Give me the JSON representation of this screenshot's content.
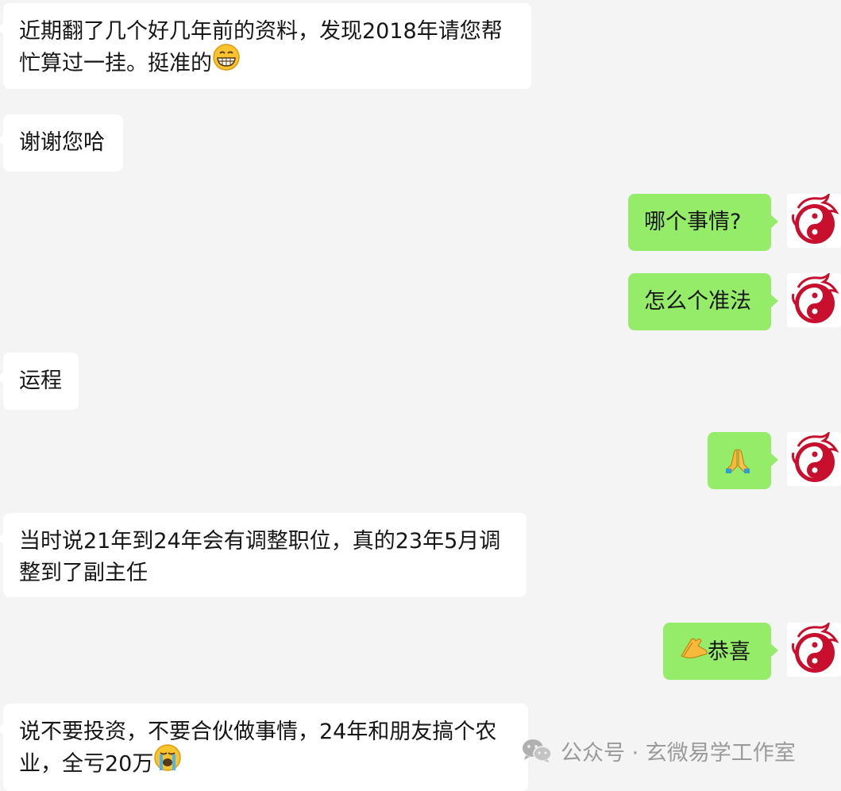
{
  "chat": {
    "messages": [
      {
        "side": "left",
        "lines": [
          "近期翻了几个好几年前的资料，发现2018年请您帮",
          "忙算过一挂。挺准的"
        ],
        "emoji": "grin-emoji"
      },
      {
        "side": "left",
        "lines": [
          "谢谢您哈"
        ]
      },
      {
        "side": "right",
        "lines": [
          "哪个事情?"
        ]
      },
      {
        "side": "right",
        "lines": [
          "怎么个准法"
        ]
      },
      {
        "side": "left",
        "lines": [
          "运程"
        ]
      },
      {
        "side": "right",
        "lines": [
          ""
        ],
        "emoji": "pray-emoji"
      },
      {
        "side": "left",
        "lines": [
          "当时说21年到24年会有调整职位，真的23年5月调",
          "整到了副主任"
        ]
      },
      {
        "side": "right",
        "lines": [
          "恭喜"
        ],
        "emoji": "clap-emoji"
      },
      {
        "side": "left",
        "lines": [
          "说不要投资，不要合伙做事情，24年和朋友搞个农",
          "业，全亏20万"
        ],
        "emoji": "crying-emoji"
      }
    ]
  },
  "watermark": {
    "label": "公众号 · 玄微易学工作室"
  },
  "colors": {
    "background": "#f4f4f4",
    "left_bubble": "#ffffff",
    "right_bubble": "#95ec69",
    "avatar_red": "#c8102e"
  }
}
